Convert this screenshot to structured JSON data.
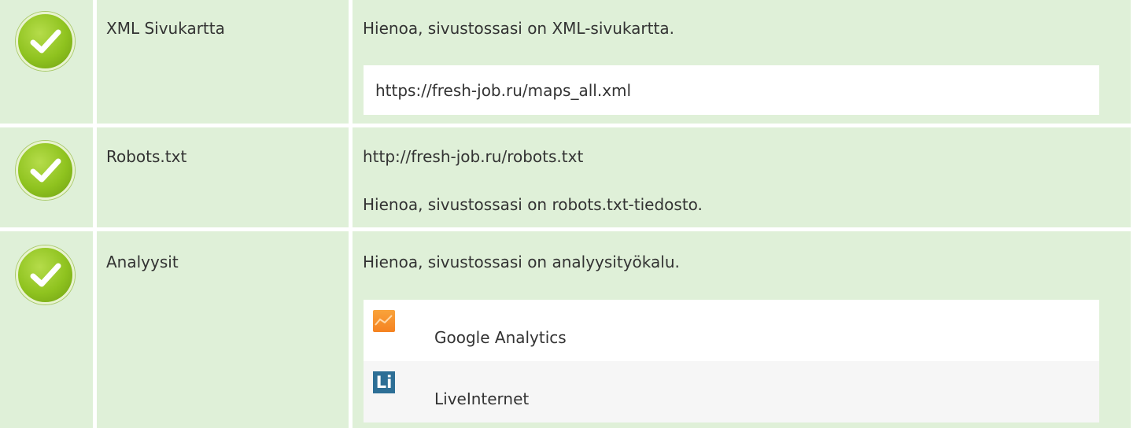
{
  "rows": [
    {
      "name": "XML Sivukartta",
      "status": "pass",
      "message": "Hienoa, sivustossasi on XML-sivukartta.",
      "url": "https://fresh-job.ru/maps_all.xml"
    },
    {
      "name": "Robots.txt",
      "status": "pass",
      "url": "http://fresh-job.ru/robots.txt",
      "message": "Hienoa, sivustossasi on robots.txt-tiedosto."
    },
    {
      "name": "Analyysit",
      "status": "pass",
      "message": "Hienoa, sivustossasi on analyysityökalu.",
      "tools": [
        {
          "label": "Google Analytics",
          "icon": "google-analytics-icon"
        },
        {
          "label": "LiveInternet",
          "icon": "liveinternet-icon",
          "icon_text": "Li"
        }
      ]
    }
  ],
  "colors": {
    "row_bg": "#dff0d8",
    "check_green": "#8fc31f",
    "ga_orange": "#f58220",
    "li_blue": "#2d6f96"
  }
}
